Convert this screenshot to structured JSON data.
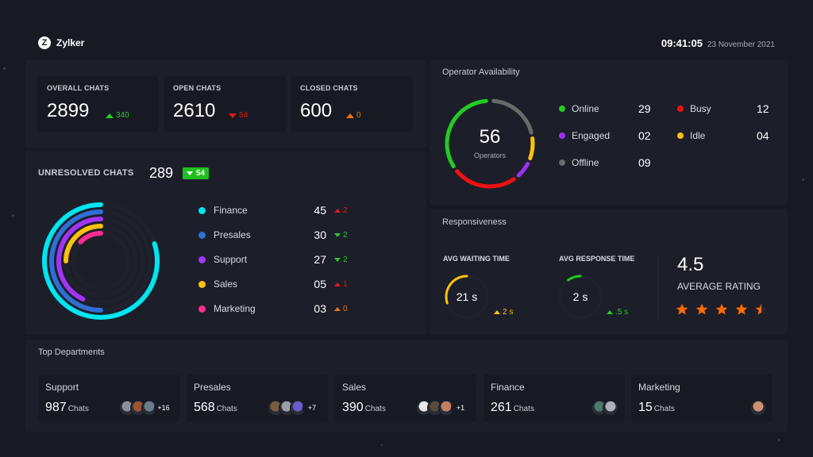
{
  "header": {
    "brand_letter": "Z",
    "brand_name": "Zylker",
    "time": "09:41:05",
    "date": "23 November 2021"
  },
  "kpis": [
    {
      "label": "OVERALL CHATS",
      "value": "2899",
      "delta": "340",
      "direction": "up",
      "color": "#22cc22"
    },
    {
      "label": "OPEN CHATS",
      "value": "2610",
      "delta": "54",
      "direction": "down",
      "color": "#e01818"
    },
    {
      "label": "CLOSED CHATS",
      "value": "600",
      "delta": "0",
      "direction": "up",
      "color": "#f07010"
    }
  ],
  "unresolved": {
    "title": "UNRESOLVED CHATS",
    "count": "289",
    "badge_delta": "54",
    "badge_direction": "down",
    "departments": [
      {
        "name": "Finance",
        "value": "45",
        "delta": "2",
        "direction": "up",
        "dot_color": "#00e5f0",
        "delta_color": "#e01818",
        "fill": 0.8
      },
      {
        "name": "Presales",
        "value": "30",
        "delta": "2",
        "direction": "down",
        "dot_color": "#2f6fd6",
        "delta_color": "#22cc22",
        "fill": 0.5
      },
      {
        "name": "Support",
        "value": "27",
        "delta": "2",
        "direction": "down",
        "dot_color": "#a235f5",
        "delta_color": "#22cc22",
        "fill": 0.43
      },
      {
        "name": "Sales",
        "value": "05",
        "delta": "1",
        "direction": "up",
        "dot_color": "#ffc10e",
        "delta_color": "#e01818",
        "fill": 0.25
      },
      {
        "name": "Marketing",
        "value": "03",
        "delta": "0",
        "direction": "up",
        "dot_color": "#ff2d8e",
        "delta_color": "#f07010",
        "fill": 0.13
      }
    ]
  },
  "operators": {
    "title": "Operator Availability",
    "total": "56",
    "total_label": "Operators",
    "statuses": [
      {
        "name": "Online",
        "value": "29",
        "color": "#22cc22"
      },
      {
        "name": "Engaged",
        "value": "02",
        "color": "#9b30f0"
      },
      {
        "name": "Offline",
        "value": "09",
        "color": "#6a6a6a"
      },
      {
        "name": "Busy",
        "value": "12",
        "color": "#ee1010"
      },
      {
        "name": "Idle",
        "value": "04",
        "color": "#ffc10e"
      }
    ]
  },
  "responsiveness": {
    "title": "Responsiveness",
    "waiting": {
      "label": "AVG WAITING TIME",
      "value": "21 s",
      "delta": "2 s",
      "direction": "up",
      "color": "#ffc10e",
      "fill": 0.3
    },
    "response": {
      "label": "AVG RESPONSE TIME",
      "value": "2 s",
      "delta": ".5 s",
      "direction": "up",
      "color": "#22cc22",
      "fill": 0.1
    },
    "rating": {
      "value": "4.5",
      "label": "AVERAGE RATING",
      "stars": 4.5,
      "max": 5,
      "color": "#ff6a00"
    }
  },
  "top_departments": {
    "title": "Top Departments",
    "chats_suffix": "Chats",
    "items": [
      {
        "name": "Support",
        "count": "987",
        "more": "+16",
        "avatars": [
          "#8a8f98",
          "#a0522d",
          "#6b7b8c"
        ]
      },
      {
        "name": "Presales",
        "count": "568",
        "more": "+7",
        "avatars": [
          "#7a5c3e",
          "#9aa0a8",
          "#6a5acd"
        ]
      },
      {
        "name": "Sales",
        "count": "390",
        "more": "+1",
        "avatars": [
          "#e8e8e8",
          "#5a4a3a",
          "#c08060"
        ]
      },
      {
        "name": "Finance",
        "count": "261",
        "more": "",
        "avatars": [
          "#4a7a6a",
          "#b0b0b8"
        ]
      },
      {
        "name": "Marketing",
        "count": "15",
        "more": "",
        "avatars": [
          "#d09070"
        ]
      }
    ]
  }
}
